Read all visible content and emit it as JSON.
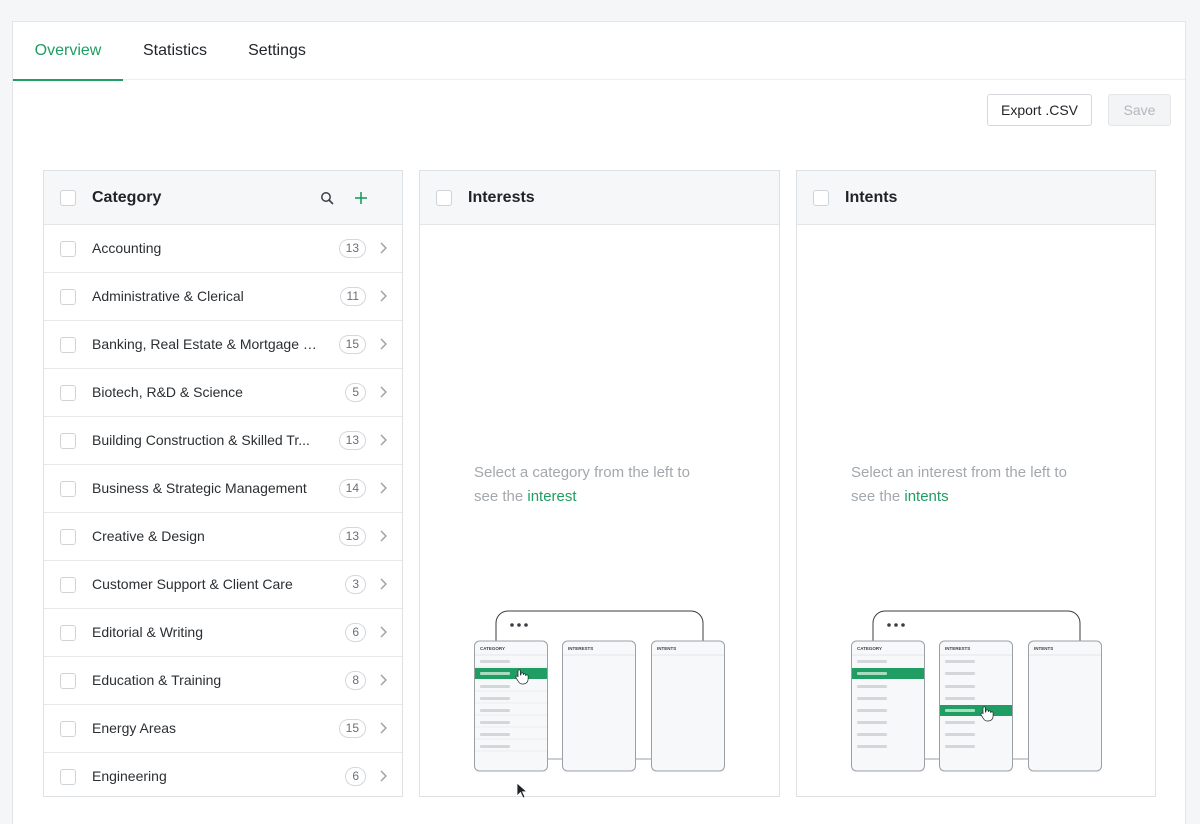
{
  "tabs": [
    {
      "label": "Overview",
      "active": true
    },
    {
      "label": "Statistics",
      "active": false
    },
    {
      "label": "Settings",
      "active": false
    }
  ],
  "toolbar": {
    "export_label": "Export .CSV",
    "save_label": "Save"
  },
  "category": {
    "title": "Category",
    "search_icon": "search-icon",
    "add_icon": "plus-icon",
    "items": [
      {
        "label": "Accounting",
        "count": "13"
      },
      {
        "label": "Administrative & Clerical",
        "count": "11"
      },
      {
        "label": "Banking, Real Estate & Mortgage P...",
        "count": "15"
      },
      {
        "label": "Biotech, R&D & Science",
        "count": "5"
      },
      {
        "label": "Building Construction & Skilled Tr...",
        "count": "13"
      },
      {
        "label": "Business & Strategic Management",
        "count": "14"
      },
      {
        "label": "Creative & Design",
        "count": "13"
      },
      {
        "label": "Customer Support & Client Care",
        "count": "3"
      },
      {
        "label": "Editorial & Writing",
        "count": "6"
      },
      {
        "label": "Education & Training",
        "count": "8"
      },
      {
        "label": "Energy Areas",
        "count": "15"
      },
      {
        "label": "Engineering",
        "count": "6"
      }
    ]
  },
  "interests": {
    "title": "Interests",
    "empty_line1": "Select a category from the left to",
    "empty_prefix": "see the ",
    "empty_link": "interest"
  },
  "intents": {
    "title": "Intents",
    "empty_line1": "Select an interest from the left to",
    "empty_prefix": "see the ",
    "empty_link": "intents"
  },
  "illustration": {
    "col1": "CATEGORY",
    "col2": "INTERESTS",
    "col3": "INTENTS"
  },
  "colors": {
    "accent": "#1f9d62",
    "muted": "#a3a8ad",
    "border": "#dfe2e5"
  }
}
